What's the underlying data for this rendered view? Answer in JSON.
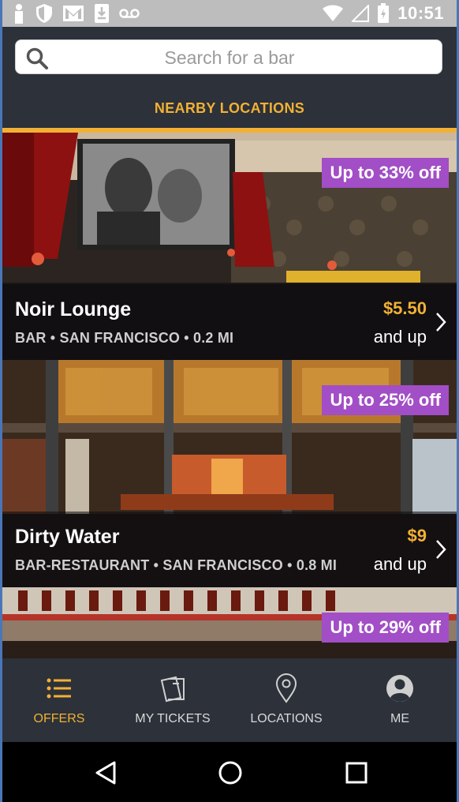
{
  "status_bar": {
    "time": "10:51",
    "left_icons": [
      "person-icon",
      "shield-icon",
      "gmail-icon",
      "download-icon",
      "voicemail-icon"
    ],
    "right_icons": [
      "wifi-icon",
      "signal-icon",
      "battery-icon"
    ]
  },
  "search": {
    "placeholder": "Search for a bar",
    "value": ""
  },
  "section": {
    "title": "NEARBY LOCATIONS"
  },
  "colors": {
    "accent": "#f2b134",
    "discount_badge": "#a24ec6",
    "panel": "#2c313a"
  },
  "venues": [
    {
      "name": "Noir Lounge",
      "meta": "BAR • SAN FRANCISCO • 0.2 MI",
      "discount": "Up to 33% off",
      "price": "$5.50",
      "price_suffix": "and up"
    },
    {
      "name": "Dirty Water",
      "meta": "BAR-RESTAURANT • SAN FRANCISCO • 0.8 MI",
      "discount": "Up to 25% off",
      "price": "$9",
      "price_suffix": "and up"
    },
    {
      "discount": "Up to 29% off"
    }
  ],
  "bottom_nav": {
    "items": [
      {
        "label": "OFFERS",
        "icon": "list-icon",
        "active": true
      },
      {
        "label": "MY TICKETS",
        "icon": "tickets-icon",
        "active": false
      },
      {
        "label": "LOCATIONS",
        "icon": "location-pin-icon",
        "active": false
      },
      {
        "label": "ME",
        "icon": "profile-icon",
        "active": false
      }
    ]
  },
  "system_nav": {
    "icons": [
      "back-icon",
      "home-icon",
      "recents-icon"
    ]
  }
}
